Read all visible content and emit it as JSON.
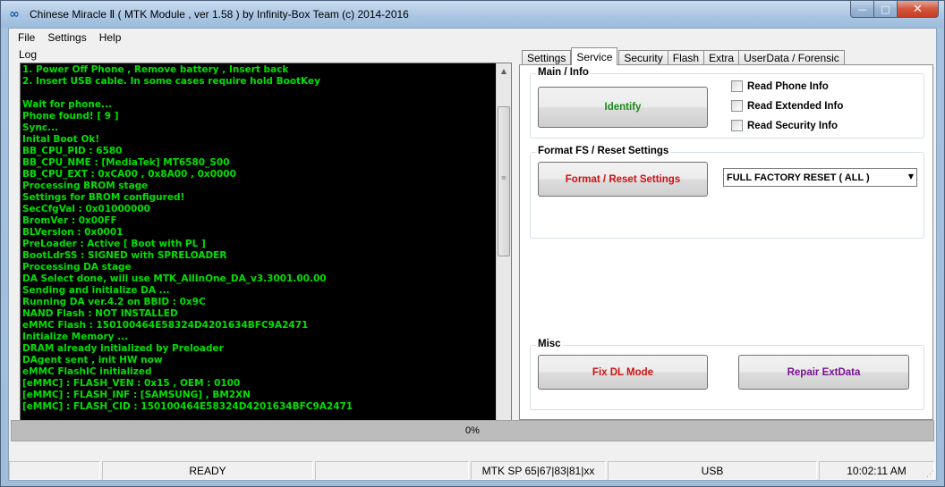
{
  "window": {
    "title": "Chinese Miracle Ⅱ ( MTK Module , ver 1.58 ) by Infinity-Box Team (c) 2014-2016",
    "app_icon": "infinity-icon",
    "minimize_glyph": "—",
    "maximize_glyph": "□",
    "close_glyph": "✕"
  },
  "menu": [
    "File",
    "Settings",
    "Help"
  ],
  "log": {
    "label": "Log",
    "text_color": "#00e000",
    "lines": [
      "1. Power Off Phone , Remove battery , Insert back",
      "2. Insert USB cable. In some cases require hold BootKey",
      "",
      "Wait for phone...",
      "Phone found! [ 9 ]",
      "Sync...",
      "Inital Boot Ok!",
      "BB_CPU_PID : 6580",
      "BB_CPU_NME : [MediaTek] MT6580_S00",
      "BB_CPU_EXT : 0xCA00 , 0x8A00 , 0x0000",
      "Processing BROM stage",
      "Settings for BROM configured!",
      "SecCfgVal : 0x01000000",
      "BromVer   : 0x00FF",
      "BLVersion : 0x0001",
      "PreLoader : Active [ Boot with PL ]",
      "BootLdrSS : SIGNED with SPRELOADER",
      "Processing DA stage",
      "DA Select done, will use MTK_AllInOne_DA_v3.3001.00.00",
      "Sending and initialize DA ...",
      "Running DA ver.4.2 on BBID : 0x9C",
      "NAND Flash : NOT INSTALLED",
      "eMMC Flash : 150100464E58324D4201634BFC9A2471",
      "Initialize Memory ...",
      "DRAM already initialized by Preloader",
      "DAgent sent , init HW now",
      "eMMC FlashIC initialized",
      "[eMMC] : FLASH_VEN : 0x15 , OEM : 0100",
      "[eMMC] : FLASH_INF : [SAMSUNG] , BM2XN",
      "[eMMC] : FLASH_CID : 150100464E58324D4201634BFC9A2471"
    ]
  },
  "tabs": [
    {
      "label": "Settings",
      "active": false
    },
    {
      "label": "Service",
      "active": true
    },
    {
      "label": "Security",
      "active": false
    },
    {
      "label": "Flash",
      "active": false
    },
    {
      "label": "Extra",
      "active": false
    },
    {
      "label": "UserData / Forensic",
      "active": false
    }
  ],
  "service": {
    "main_info": {
      "title": "Main / Info",
      "identify_label": "Identify",
      "identify_color": "#1a8a1a",
      "checkboxes": [
        "Read Phone Info",
        "Read Extended Info",
        "Read Security Info"
      ]
    },
    "format": {
      "title": "Format FS / Reset Settings",
      "button_label": "Format / Reset Settings",
      "button_color": "#d01010",
      "select_value": "FULL FACTORY RESET ( ALL )"
    },
    "misc": {
      "title": "Misc",
      "fix_dl_label": "Fix DL Mode",
      "fix_dl_color": "#d01010",
      "repair_label": "Repair ExtData",
      "repair_color": "#7a1090"
    }
  },
  "progress": {
    "text": "0%",
    "value": 0
  },
  "status": {
    "cells": [
      "",
      "READY",
      "",
      "MTK SP 65|67|83|81|xx",
      "USB",
      "10:02:11 AM"
    ]
  }
}
